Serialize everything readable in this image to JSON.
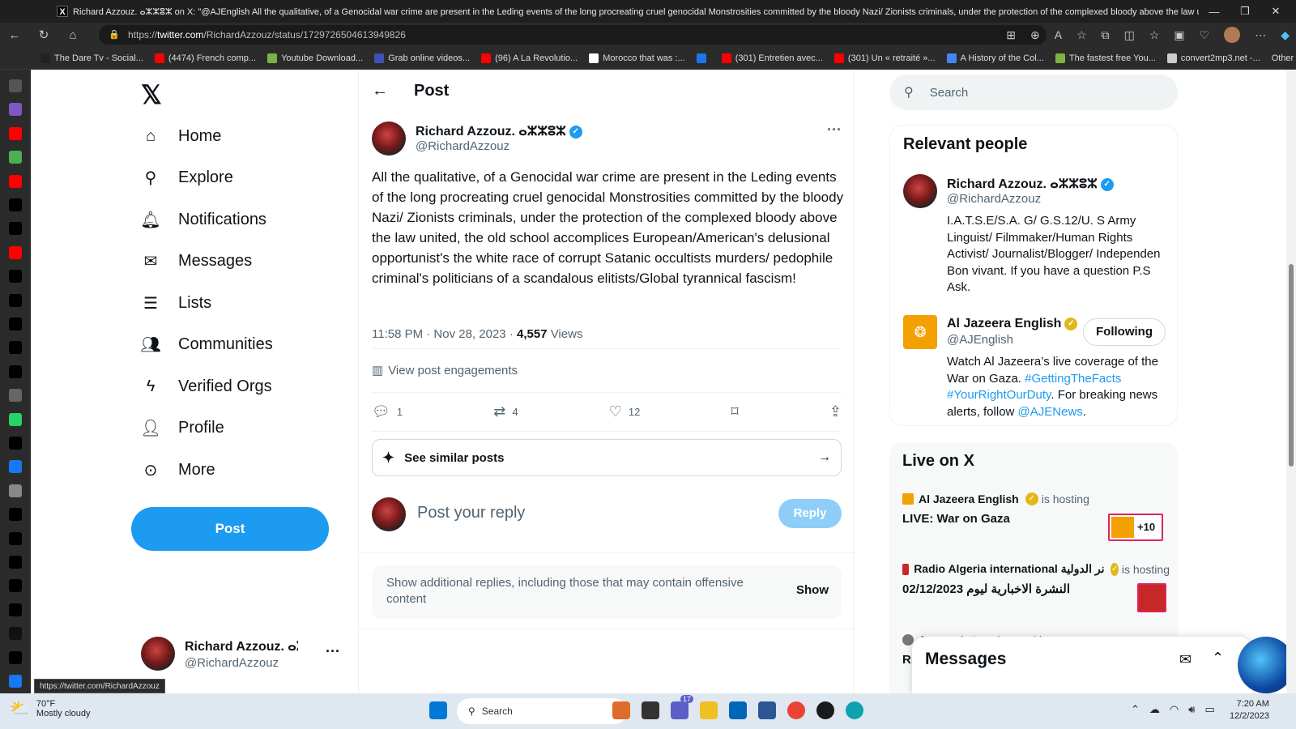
{
  "browser": {
    "window_title": "Richard Azzouz. ⴰⵣⵣⵓⵣ on X: \"@AJEnglish All the qualitative, of a Genocidal war crime are present in the Leding events of the long procreating cruel genocidal Monstrosities committed by the bloody Nazi/ Zionists criminals, under the protection of the complexed bloody above the law united, the old school acc...",
    "url_prefix": "https://",
    "url_host": "twitter.com",
    "url_path": "/RichardAzzouz/status/1729726504613949826",
    "bookmarks": [
      {
        "label": "The Dare Tv - Social...",
        "color": "#222222"
      },
      {
        "label": "(4474) French comp...",
        "color": "#ff0000"
      },
      {
        "label": "Youtube Download...",
        "color": "#7cb342"
      },
      {
        "label": "Grab online videos...",
        "color": "#3f51b5"
      },
      {
        "label": "(96) A La Revolutio...",
        "color": "#ff0000"
      },
      {
        "label": "Morocco that was :...",
        "color": "#ffffff"
      },
      {
        "label": "",
        "color": "#1877f2"
      },
      {
        "label": "(301) Entretien avec...",
        "color": "#ff0000"
      },
      {
        "label": "(301) Un « retraité »...",
        "color": "#ff0000"
      },
      {
        "label": "A History of the Col...",
        "color": "#4285f4"
      },
      {
        "label": "The fastest free You...",
        "color": "#7cb342"
      },
      {
        "label": "convert2mp3.net -...",
        "color": "#cccccc"
      }
    ],
    "other_favorites": "Other favorites",
    "status_url": "https://twitter.com/RichardAzzouz"
  },
  "nav": {
    "items": [
      {
        "label": "Home",
        "icon": "home-icon"
      },
      {
        "label": "Explore",
        "icon": "search-icon"
      },
      {
        "label": "Notifications",
        "icon": "bell-icon"
      },
      {
        "label": "Messages",
        "icon": "envelope-icon"
      },
      {
        "label": "Lists",
        "icon": "list-icon"
      },
      {
        "label": "Communities",
        "icon": "people-icon"
      },
      {
        "label": "Verified Orgs",
        "icon": "lightning-icon"
      },
      {
        "label": "Profile",
        "icon": "person-icon"
      },
      {
        "label": "More",
        "icon": "more-circle-icon"
      }
    ],
    "post_button": "Post",
    "account": {
      "name": "Richard Azzouz. ⴰⵣ",
      "handle": "@RichardAzzouz"
    }
  },
  "post": {
    "header": "Post",
    "author_name": "Richard Azzouz. ⴰⵣⵣⵓⵣ",
    "author_handle": "@RichardAzzouz",
    "text": "All the qualitative, of a Genocidal war crime are present in the Leding events of the long procreating cruel genocidal Monstrosities committed by the bloody Nazi/ Zionists criminals, under the protection of the complexed bloody above the law united, the old school accomplices European/American's delusional opportunist's the white race of corrupt Satanic occultists murders/ pedophile criminal's politicians of a scandalous elitists/Global tyrannical fascism!",
    "time": "11:58 PM · Nov 28, 2023 · ",
    "views_count": "4,557",
    "views_label": " Views",
    "engagements": "View post engagements",
    "replies": "1",
    "reposts": "4",
    "likes": "12",
    "similar": "See similar posts",
    "reply_placeholder": "Post your reply",
    "reply_button": "Reply",
    "additional_replies": "Show additional replies, including those that may contain offensive content",
    "show": "Show"
  },
  "sidebar": {
    "search_placeholder": "Search",
    "relevant_title": "Relevant people",
    "people": [
      {
        "name": "Richard Azzouz. ⴰⵣⵣⵓⵣ",
        "handle": "@RichardAzzouz",
        "bio": "I.A.T.S.E/S.A. G/ G.S.12/U. S Army Linguist/ Filmmaker/Human Rights Activist/ Journalist/Blogger/ Independen Bon vivant. If you have a question P.S Ask."
      },
      {
        "name": "Al Jazeera English",
        "handle": "@AJEnglish",
        "follow": "Following",
        "bio_start": "Watch Al Jazeera’s live coverage of the War on Gaza. ",
        "tag1": "#GettingTheFacts",
        "tag2": "#YourRightOurDuty",
        "bio_mid": ". For breaking news alerts, follow ",
        "mention": "@AJENews",
        "bio_end": "."
      }
    ],
    "live_title": "Live on X",
    "live": [
      {
        "host": "Al Jazeera English",
        "suffix": "is hosting",
        "title": "LIVE: War on Gaza",
        "extra": "+10"
      },
      {
        "host": "Radio Algeria international نر الدولية",
        "suffix": "is hosting",
        "title": "النشرة الاخبارية ليوم 02/12/2023"
      },
      {
        "host": "Amar m'a tuer",
        "suffix": "is speaking",
        "title": "Rien"
      }
    ],
    "messages_title": "Messages"
  },
  "taskbar": {
    "temp": "70°F",
    "weather": "Mostly cloudy",
    "search": "Search",
    "time": "7:20 AM",
    "date": "12/2/2023",
    "badge": "17"
  }
}
